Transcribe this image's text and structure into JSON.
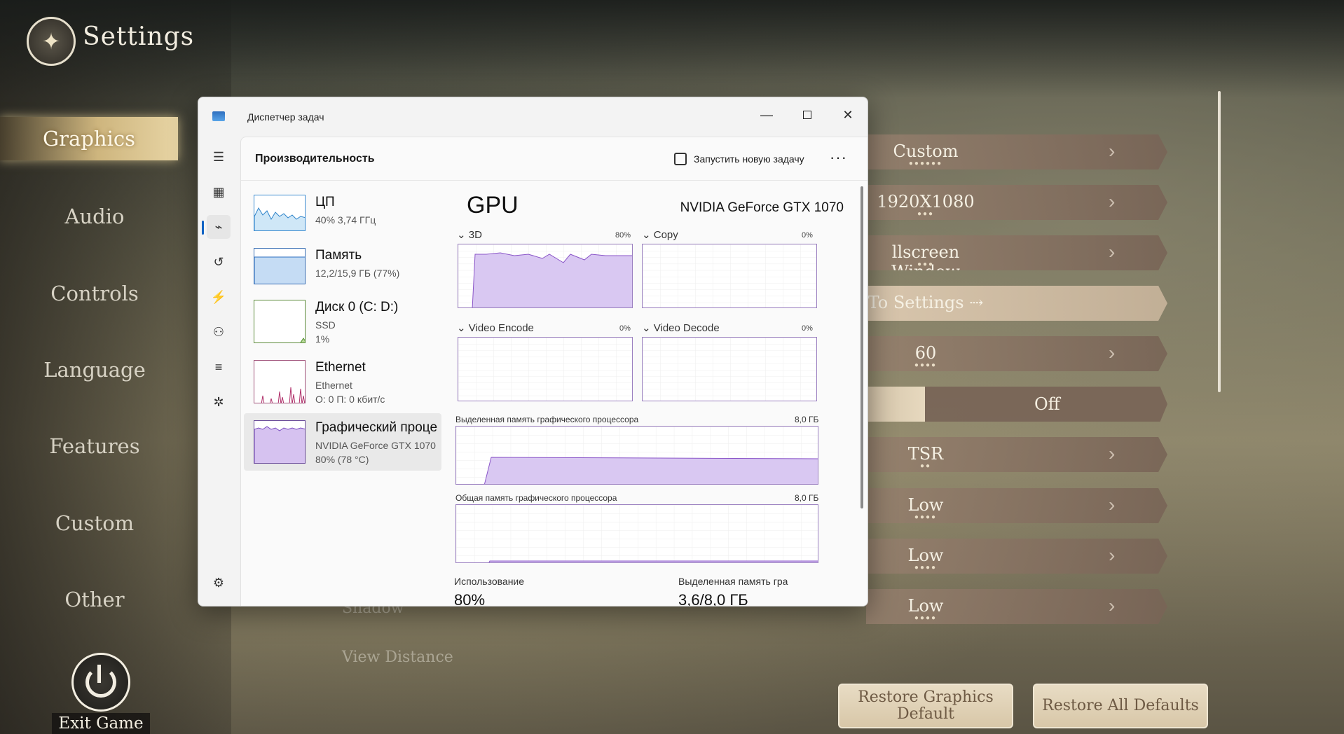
{
  "game": {
    "title": "Settings",
    "nav": [
      "Graphics",
      "Audio",
      "Controls",
      "Language",
      "Features",
      "Custom",
      "Other"
    ],
    "active_nav": "Graphics",
    "exit_label": "Exit Game",
    "rows": [
      {
        "value": "Custom",
        "dots": "●●●●●●"
      },
      {
        "value": "1920X1080",
        "dots": "●●●"
      },
      {
        "value": "llscreen Window",
        "dots": "●●●"
      },
      {
        "value": "To Settings ⇢",
        "dots": ""
      },
      {
        "value": "60",
        "dots": "●●●●"
      },
      {
        "value": "TSR",
        "dots": "●●"
      },
      {
        "value": "Low",
        "dots": "●●●●"
      },
      {
        "value": "Low",
        "dots": "●●●●"
      },
      {
        "value": "Low",
        "dots": "●●●●"
      }
    ],
    "toggle_off": "Off",
    "obscured": [
      "Shadow",
      "View Distance"
    ],
    "restore_graphics": "Restore Graphics Default",
    "restore_all": "Restore All Defaults"
  },
  "taskmgr": {
    "window_title": "Диспетчер задач",
    "page_title": "Производительность",
    "run_task": "Запустить новую задачу",
    "resources": [
      {
        "name": "ЦП",
        "sub1": "40% 3,74 ГГц",
        "sub2": ""
      },
      {
        "name": "Память",
        "sub1": "12,2/15,9 ГБ (77%)",
        "sub2": ""
      },
      {
        "name": "Диск 0 (C: D:)",
        "sub1": "SSD",
        "sub2": "1%"
      },
      {
        "name": "Ethernet",
        "sub1": "Ethernet",
        "sub2": "О: 0 П: 0 кбит/с"
      },
      {
        "name": "Графический проце",
        "sub1": "NVIDIA GeForce GTX 1070",
        "sub2": "80% (78 °C)"
      }
    ],
    "gpu": {
      "title": "GPU",
      "model": "NVIDIA GeForce GTX 1070",
      "engines": [
        {
          "label": "3D",
          "pct": "80%"
        },
        {
          "label": "Copy",
          "pct": "0%"
        },
        {
          "label": "Video Encode",
          "pct": "0%"
        },
        {
          "label": "Video Decode",
          "pct": "0%"
        }
      ],
      "dedicated_label": "Выделенная память графического процессора",
      "dedicated_max": "8,0 ГБ",
      "shared_label": "Общая память графического процессора",
      "shared_max": "8,0 ГБ",
      "usage_label": "Использование",
      "usage_value": "80%",
      "ded_mem_label": "Выделенная память гра",
      "ded_mem_value": "3,6/8,0 ГБ"
    }
  }
}
